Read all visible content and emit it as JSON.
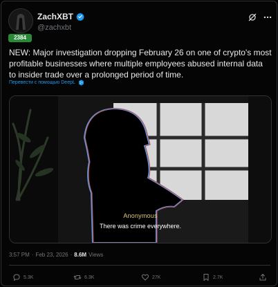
{
  "author": {
    "display_name": "ZachXBT",
    "handle": "@zachxbt",
    "avatar_badge": "2384"
  },
  "tweet": {
    "text": "NEW: Major investigation dropping February 26 on one of crypto's most profitable businesses where multiple employees abused internal data to insider trade over a prolonged period of time.",
    "translate_link": "Перевести с помощью DeepL"
  },
  "media": {
    "caption_name": "Anonymous",
    "caption_line": "There was crime everywhere."
  },
  "meta": {
    "time": "3:57 PM",
    "separator": "·",
    "date": "Feb 23, 2026",
    "separator2": "·",
    "views_count": "8.6M",
    "views_label": "Views"
  },
  "actions": {
    "replies": "5.3K",
    "reposts": "6.3K",
    "likes": "27K",
    "bookmarks": "2.7K"
  },
  "colors": {
    "accent": "#1d9bf0",
    "verified": "#1d9bf0",
    "badge_green": "#2a8a3a",
    "caption_yellow": "#e0c878"
  },
  "icons": [
    "verified-icon",
    "grok-icon",
    "more-icon",
    "deepl-icon",
    "reply-icon",
    "repost-icon",
    "like-icon",
    "bookmark-icon",
    "share-icon"
  ]
}
